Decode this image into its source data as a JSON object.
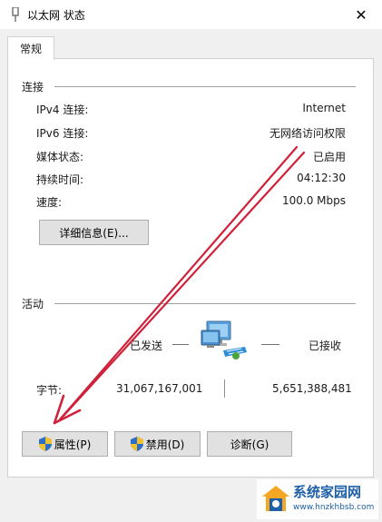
{
  "window": {
    "title": "以太网 状态",
    "close": "✕"
  },
  "tab": {
    "label": "常规"
  },
  "connection": {
    "title": "连接",
    "rows": [
      {
        "label": "IPv4 连接:",
        "value": "Internet"
      },
      {
        "label": "IPv6 连接:",
        "value": "无网络访问权限"
      },
      {
        "label": "媒体状态:",
        "value": "已启用"
      },
      {
        "label": "持续时间:",
        "value": "04:12:30"
      },
      {
        "label": "速度:",
        "value": "100.0 Mbps"
      }
    ],
    "details_button": "详细信息(E)..."
  },
  "activity": {
    "title": "活动",
    "sent_label": "已发送",
    "received_label": "已接收",
    "bytes_label": "字节:",
    "bytes_sent": "31,067,167,001",
    "bytes_received": "5,651,388,481"
  },
  "buttons": {
    "properties": "属性(P)",
    "disable": "禁用(D)",
    "diagnose": "诊断(G)"
  },
  "watermark": {
    "name": "系统家园网",
    "url": "www.hnzkhbsb.com"
  },
  "colors": {
    "arrow": "#d0213a",
    "shield_blue": "#2a6fc9",
    "shield_yellow": "#f2c12e"
  }
}
